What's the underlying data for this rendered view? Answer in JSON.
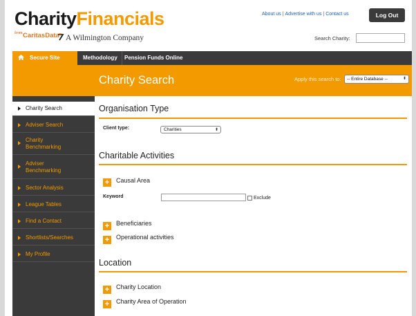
{
  "brand": {
    "title_part1": "Charity",
    "title_part2": "Financials",
    "from": "from",
    "caritas": "CaritasData",
    "company": "A Wilmington Company"
  },
  "toplinks": {
    "about": "About us",
    "advertise": "Advertise with us",
    "contact": "Contact us",
    "separator": "|"
  },
  "logout_label": "Log Out",
  "search": {
    "label": "Search Charity:",
    "value": ""
  },
  "nav": {
    "secure": "Secure Site",
    "methodology": "Methodology",
    "pension": "Pension Funds Online"
  },
  "band": {
    "title": "Charity Search",
    "apply_label": "Apply this search to:",
    "apply_value": "-- Entire Database --"
  },
  "sidebar": {
    "items": [
      {
        "line1": "Charity Search",
        "line2": ""
      },
      {
        "line1": "Adviser Search",
        "line2": ""
      },
      {
        "line1": "Charity",
        "line2": "Benchmarking"
      },
      {
        "line1": "Adviser",
        "line2": "Benchmarking"
      },
      {
        "line1": "Sector Analysis",
        "line2": ""
      },
      {
        "line1": "League Tables",
        "line2": ""
      },
      {
        "line1": "Find a Contact",
        "line2": ""
      },
      {
        "line1": "Shortlists/Searches",
        "line2": ""
      },
      {
        "line1": "My Profile",
        "line2": ""
      }
    ]
  },
  "org": {
    "heading": "Organisation Type",
    "client_type_label": "Client type:",
    "client_type_value": "Charities"
  },
  "activities": {
    "heading": "Charitable Activities",
    "causal_area": "Causal Area",
    "keyword_label": "Keyword",
    "keyword_value": "",
    "exclude_label": "Exclude",
    "beneficiaries": "Beneficiaries",
    "operational": "Operational activities"
  },
  "location": {
    "heading": "Location",
    "charity_location": "Charity Location",
    "area_of_operation": "Charity Area of Operation"
  },
  "plus_symbol": "+",
  "select_arrow": "⬍",
  "colors": {
    "accent": "#f39a00",
    "dark": "#3a3a3a",
    "link": "#1f5fb4"
  }
}
